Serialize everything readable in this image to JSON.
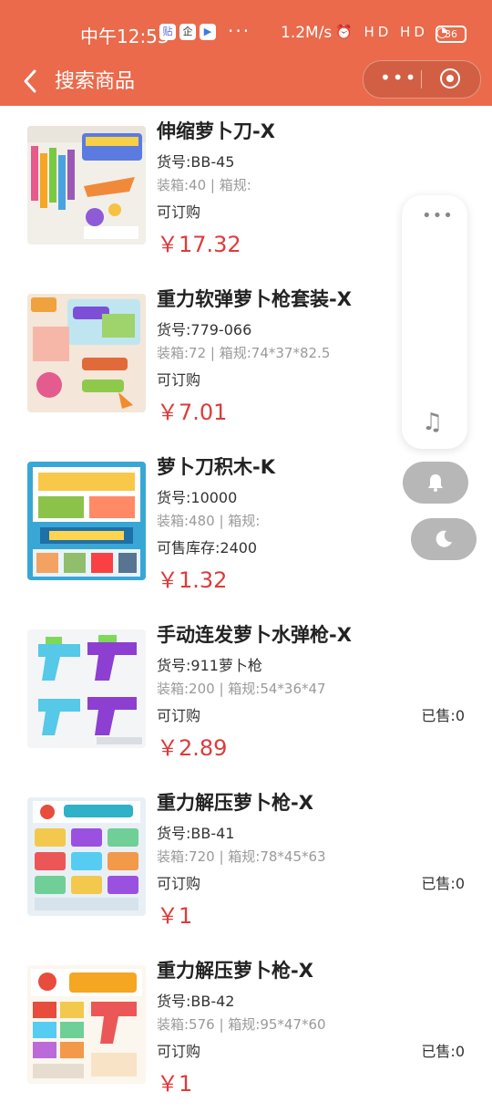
{
  "status_bar": {
    "time": "中午12:53",
    "badges": [
      "贴",
      "企",
      "▶"
    ],
    "more": "···",
    "speed": "1.2M/s",
    "icons": "⏰ HD HD ◔",
    "battery": "36"
  },
  "nav": {
    "title": "搜索商品",
    "more_label": "•••"
  },
  "products": [
    {
      "name": "伸缩萝卜刀-X",
      "code": "货号:BB-45",
      "spec": "装箱:40 | 箱规:",
      "stock": "可订购",
      "sold": "",
      "price": "￥17.32",
      "image_icon": "carrot-knife-toy"
    },
    {
      "name": "重力软弹萝卜枪套装-X",
      "code": "货号:779-066",
      "spec": "装箱:72 | 箱规:74*37*82.5",
      "stock": "可订购",
      "sold": "",
      "price": "￥7.01",
      "image_icon": "soft-bullet-gun-set"
    },
    {
      "name": "萝卜刀积木-K",
      "code": "货号:10000",
      "spec": "装箱:480 | 箱规:",
      "stock": "可售库存:2400",
      "sold": "",
      "price": "￥1.32",
      "image_icon": "carrot-knife-blocks"
    },
    {
      "name": "手动连发萝卜水弹枪-X",
      "code": "货号:911萝卜枪",
      "spec": "装箱:200 | 箱规:54*36*47",
      "stock": "可订购",
      "sold": "已售:0",
      "price": "￥2.89",
      "image_icon": "water-gun"
    },
    {
      "name": "重力解压萝卜枪-X",
      "code": "货号:BB-41",
      "spec": "装箱:720 | 箱规:78*45*63",
      "stock": "可订购",
      "sold": "已售:0",
      "price": "￥1",
      "image_icon": "gravity-carrot-gun"
    },
    {
      "name": "重力解压萝卜枪-X",
      "code": "货号:BB-42",
      "spec": "装箱:576 | 箱规:95*47*60",
      "stock": "可订购",
      "sold": "已售:0",
      "price": "￥1",
      "image_icon": "gravity-carrot-gun"
    }
  ],
  "colors": {
    "header": "#ea6a4b",
    "price": "#e03a3a",
    "float_button": "#b7b7b7"
  },
  "floating": {
    "dots": "•••",
    "music_icon": "♫"
  }
}
